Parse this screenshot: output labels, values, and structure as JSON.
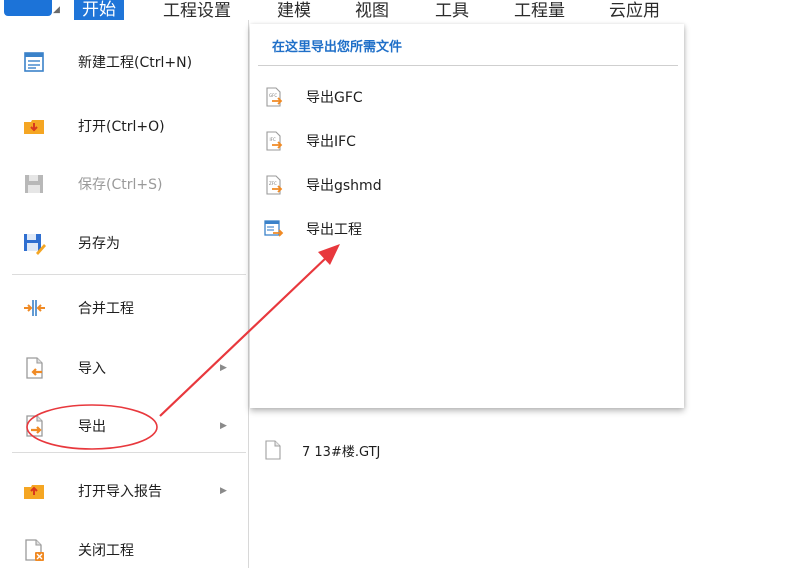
{
  "menubar": {
    "tabs": [
      {
        "label": "开始",
        "active": true
      },
      {
        "label": "工程设置"
      },
      {
        "label": "建模"
      },
      {
        "label": "视图"
      },
      {
        "label": "工具"
      },
      {
        "label": "工程量"
      },
      {
        "label": "云应用"
      }
    ]
  },
  "left_menu": {
    "items": [
      {
        "label": "新建工程(Ctrl+N)",
        "icon": "new-project-icon"
      },
      {
        "label": "打开(Ctrl+O)",
        "icon": "open-folder-icon"
      },
      {
        "label": "保存(Ctrl+S)",
        "icon": "save-disk-icon",
        "disabled": true
      },
      {
        "label": "另存为",
        "icon": "save-as-icon"
      },
      {
        "label": "合并工程",
        "icon": "merge-icon"
      },
      {
        "label": "导入",
        "icon": "import-icon",
        "has_submenu": true
      },
      {
        "label": "导出",
        "icon": "export-icon",
        "has_submenu": true,
        "selected": true
      },
      {
        "label": "打开导入报告",
        "icon": "open-report-icon",
        "has_submenu": true
      },
      {
        "label": "关闭工程",
        "icon": "close-project-icon"
      }
    ]
  },
  "export_submenu": {
    "title": "在这里导出您所需文件",
    "items": [
      {
        "label": "导出GFC",
        "icon": "export-gfc-icon"
      },
      {
        "label": "导出IFC",
        "icon": "export-ifc-icon"
      },
      {
        "label": "导出gshmd",
        "icon": "export-gshmd-icon"
      },
      {
        "label": "导出工程",
        "icon": "export-project-icon"
      }
    ]
  },
  "recent_files": [
    {
      "label": "7 13#楼.GTJ",
      "icon": "file-icon"
    }
  ],
  "colors": {
    "accent": "#1f75d8",
    "annotation": "#e8383d",
    "title_blue": "#1f6fc8",
    "folder_orange": "#f5a623"
  }
}
